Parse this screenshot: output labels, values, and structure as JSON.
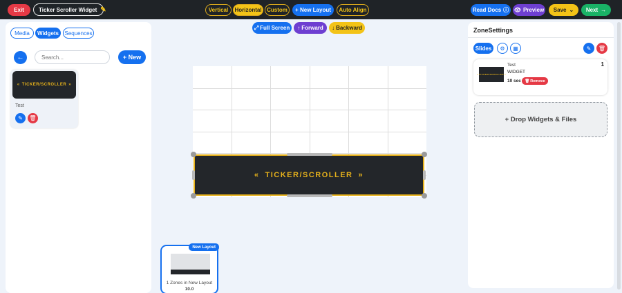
{
  "topbar": {
    "exit_label": "Exit",
    "widget_title": "Ticker Scroller Widget",
    "modes": [
      "Vertical",
      "Horizontal",
      "Custom"
    ],
    "active_mode": "Horizontal",
    "new_layout_label": "+ New Layout",
    "auto_align_label": "Auto Align",
    "read_docs_label": "Read Docs",
    "preview_label": "Preview",
    "save_label": "Save",
    "next_label": "Next"
  },
  "left_panel": {
    "tabs": [
      "Media",
      "Widgets",
      "Sequences"
    ],
    "active_tab": "Widgets",
    "search_placeholder": "Search...",
    "new_label": "+ New",
    "widgets": [
      {
        "name": "Test",
        "thumb_text": "TICKER/SCROLLER"
      }
    ]
  },
  "canvas_toolbar": {
    "fullscreen_label": "Full Screen",
    "forward_label": "Forward",
    "backward_label": "Backward"
  },
  "canvas": {
    "zone_text": "TICKER/SCROLLER"
  },
  "layout_card": {
    "badge": "New Layout",
    "caption": "1 Zones in New Layout",
    "duration": "10.0"
  },
  "right_panel": {
    "title": "ZoneSettings",
    "slides_tab": "Slides",
    "slides": [
      {
        "name": "Test",
        "type": "WIDGET",
        "duration": "10 sec",
        "remove_label": "Remove",
        "index": "1",
        "thumb_text": "TICKER/SCROLLER"
      }
    ],
    "drop_label": "+ Drop Widgets & Files"
  },
  "colors": {
    "primary": "#1570ef",
    "purple": "#6e3fd1",
    "yellow": "#f3c317",
    "green": "#19b266",
    "red": "#e53945",
    "topbar": "#1f2327"
  }
}
